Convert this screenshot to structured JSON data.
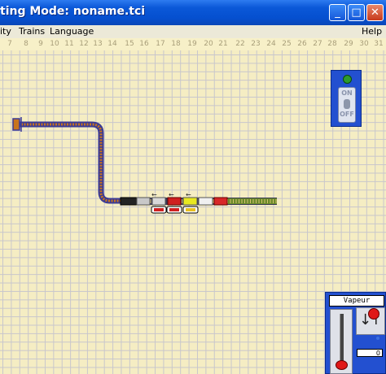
{
  "window": {
    "title": "ting Mode: noname.tci",
    "buttons": {
      "minimize": "_",
      "maximize": "□",
      "close": "✕"
    }
  },
  "menu": {
    "items": [
      "ity",
      "Trains",
      "Language"
    ],
    "help": "Help"
  },
  "ruler": {
    "numbers": [
      "7",
      "8",
      "9",
      "10",
      "11",
      "12",
      "13",
      "14",
      "15",
      "16",
      "17",
      "18",
      "19",
      "20",
      "21",
      "22",
      "23",
      "24",
      "25",
      "26",
      "27",
      "28",
      "29",
      "30",
      "31"
    ]
  },
  "power_panel": {
    "led_color": "#2e9a2e",
    "switch_on_label": "ON",
    "switch_off_label": "OFF",
    "state": "ON"
  },
  "throttle": {
    "name": "Vapeur",
    "speed": "0",
    "speed_fraction": 0
  },
  "colors": {
    "track_outer": "#3a3a96",
    "track_inner": "#c8741e",
    "track_green": "#6a8a2a",
    "panel_blue": "#2350d0",
    "grid_bg": "#f5edc3"
  }
}
